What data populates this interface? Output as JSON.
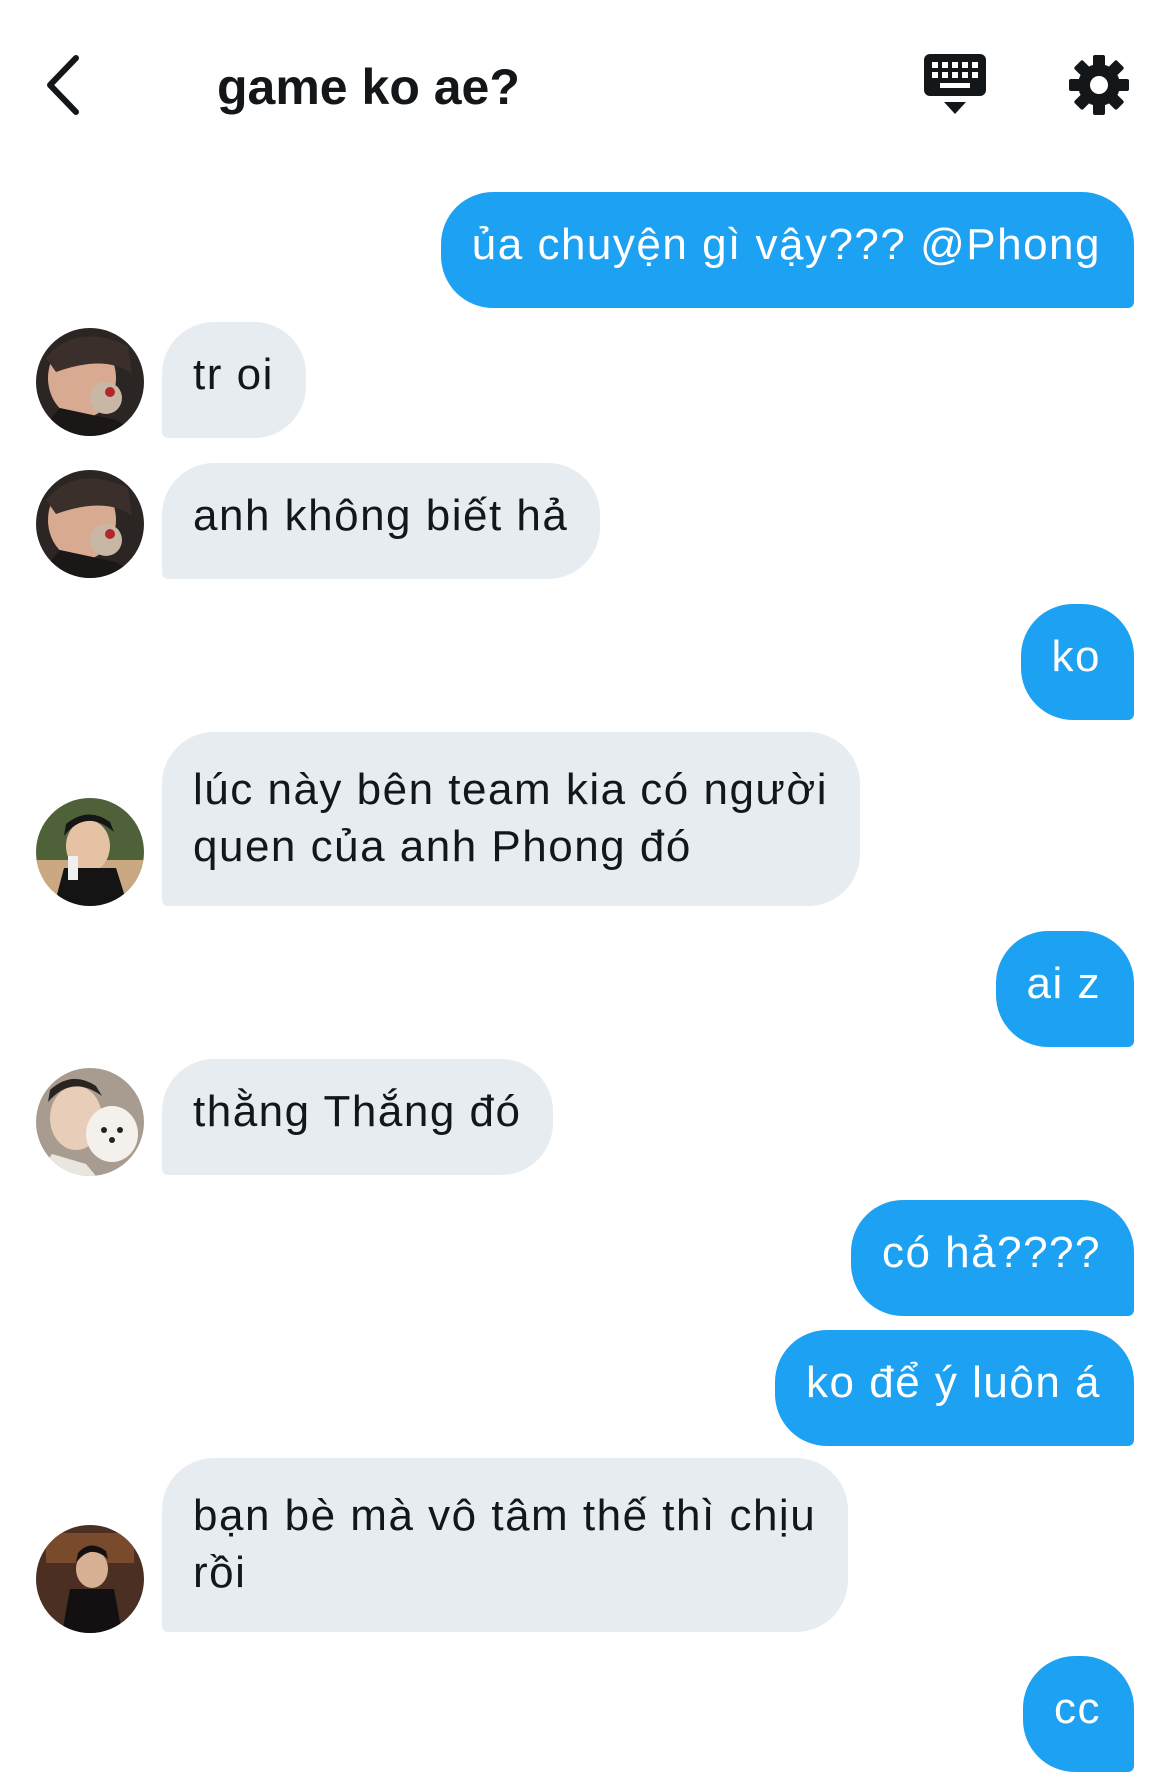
{
  "header": {
    "title": "game ko ae?"
  },
  "messages": [
    {
      "direction": "out",
      "text": "ủa chuyện gì vậy??? @Phong"
    },
    {
      "direction": "in",
      "sender": "avatar-1",
      "text": "tr oi"
    },
    {
      "direction": "in",
      "sender": "avatar-1",
      "text": "anh không biết hả"
    },
    {
      "direction": "out",
      "text": "ko"
    },
    {
      "direction": "in",
      "sender": "avatar-2",
      "lines": [
        "lúc này bên team kia có người",
        "quen của anh Phong đó"
      ]
    },
    {
      "direction": "out",
      "text": "ai z"
    },
    {
      "direction": "in",
      "sender": "avatar-3",
      "text": "thằng Thắng đó"
    },
    {
      "direction": "out",
      "text": "có hả????"
    },
    {
      "direction": "out",
      "text": "ko để ý luôn á"
    },
    {
      "direction": "in",
      "sender": "avatar-4",
      "lines": [
        "bạn bè mà vô tâm thế thì chịu",
        "rồi"
      ]
    },
    {
      "direction": "out",
      "text": "cc"
    }
  ],
  "colors": {
    "outgoing_bubble": "#1da1f2",
    "incoming_bubble": "#e6ecf0",
    "text_dark": "#14171a"
  },
  "icons": {
    "back": "chevron-left-icon",
    "keyboard": "keyboard-icon",
    "settings": "gear-icon"
  }
}
